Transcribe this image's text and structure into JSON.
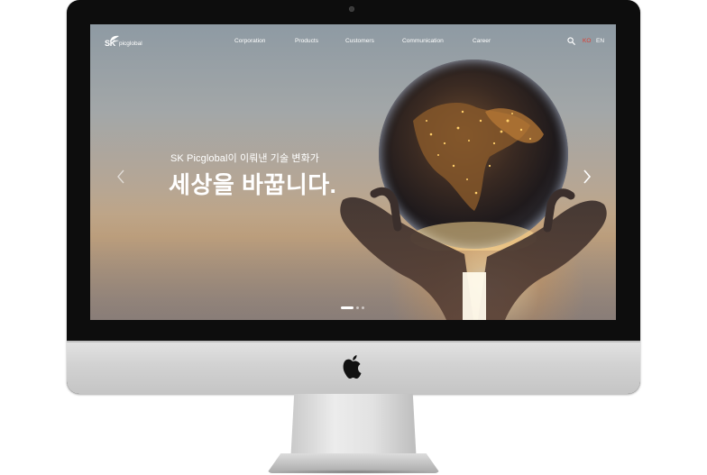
{
  "brand": {
    "logo_main": "SK",
    "logo_sub": "picglobal"
  },
  "nav": {
    "items": [
      {
        "label": "Corporation"
      },
      {
        "label": "Products"
      },
      {
        "label": "Customers"
      },
      {
        "label": "Communication"
      },
      {
        "label": "Career"
      }
    ],
    "search_icon": "search-icon",
    "lang_ko": "KO",
    "lang_en": "EN"
  },
  "hero": {
    "subtitle": "SK Picglobal이 이뤄낸 기술 변화가",
    "title": "세상을 바꿉니다.",
    "slide_count": 3,
    "active_slide": 1
  },
  "colors": {
    "accent_lang": "#e03a2f",
    "text": "#ffffff",
    "bezel": "#0d0d0d"
  },
  "icons": {
    "prev": "chevron-left-icon",
    "next": "chevron-right-icon",
    "device_logo": "apple-logo-icon"
  }
}
